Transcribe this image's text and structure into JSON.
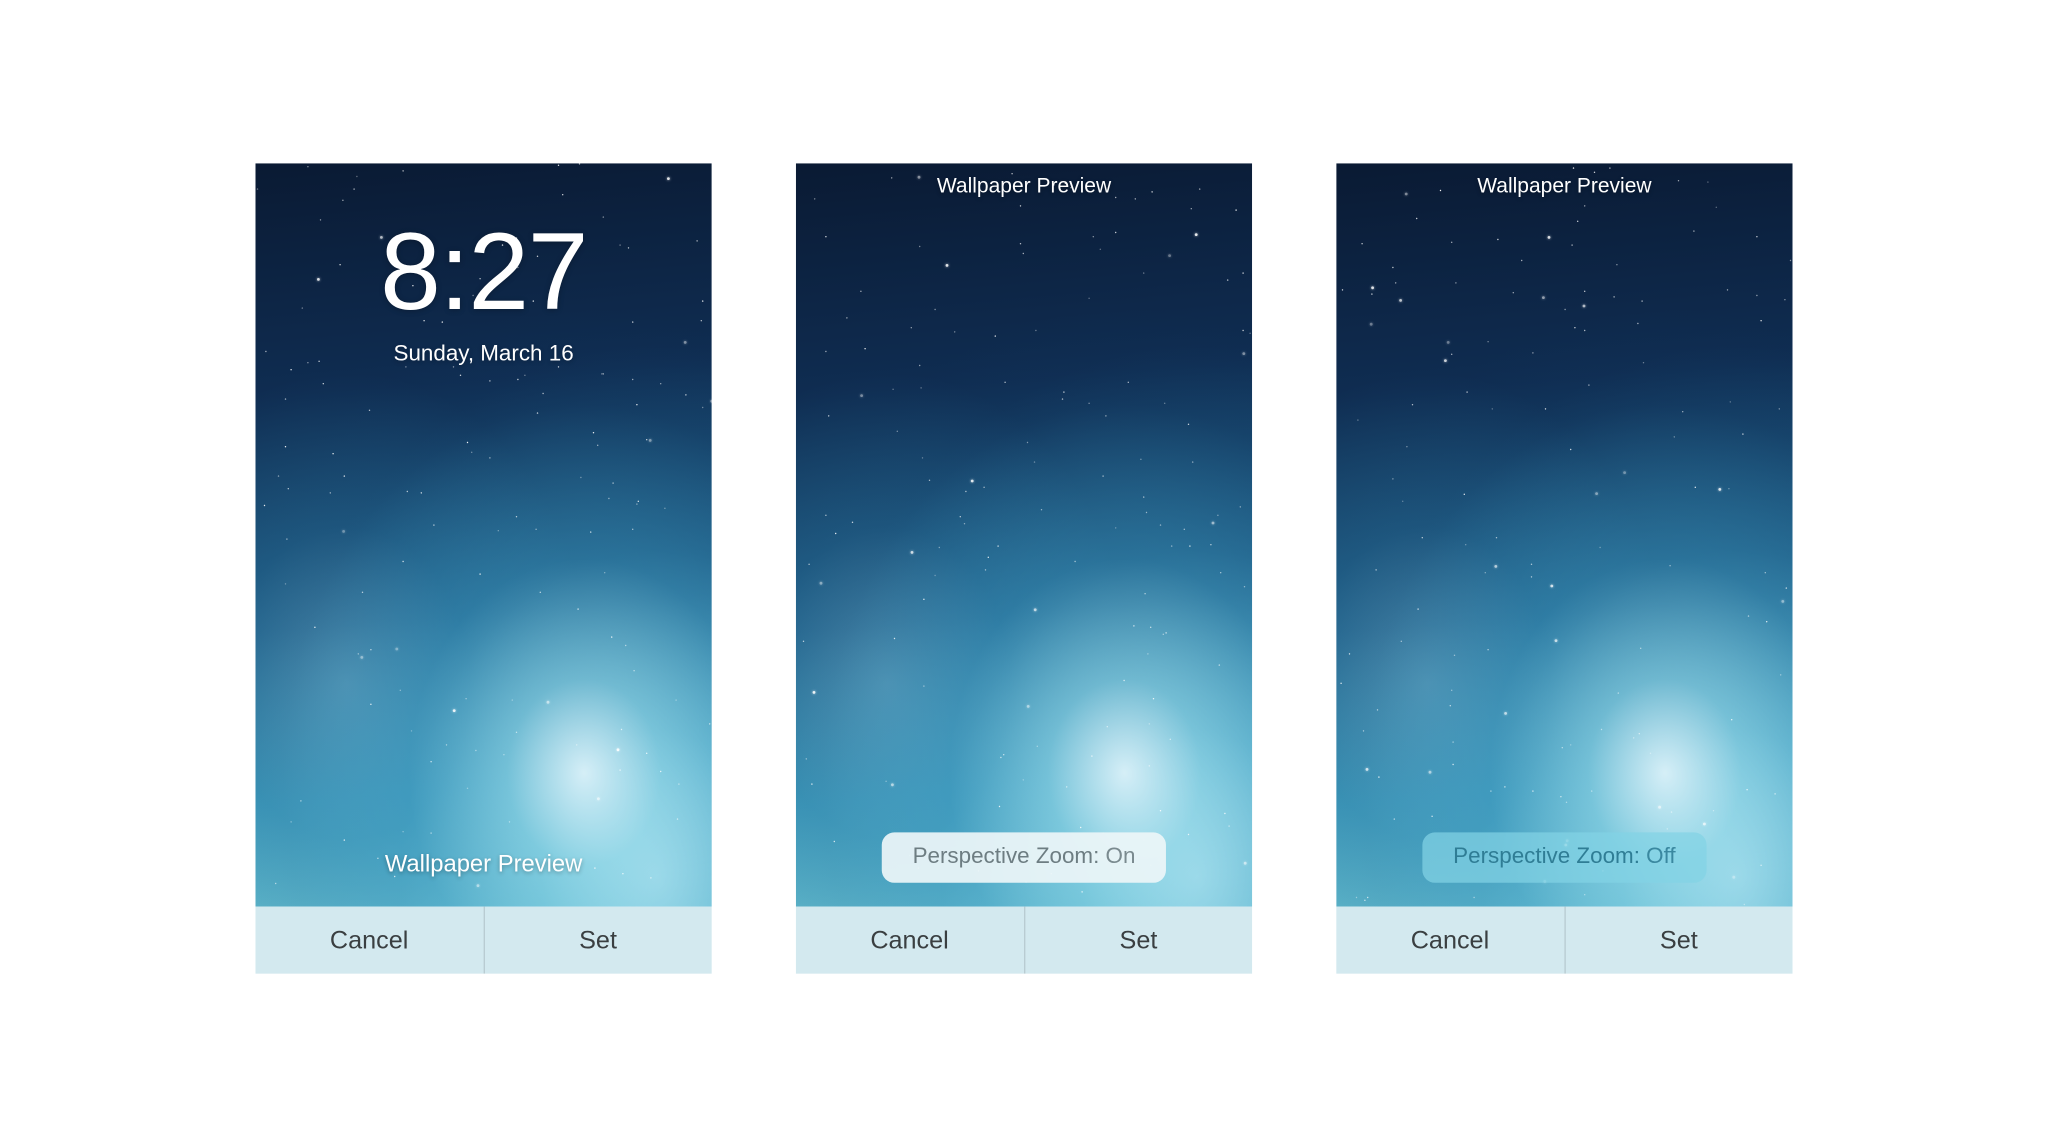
{
  "screens": [
    {
      "header_title": "",
      "lock_time": "8:27",
      "lock_date": "Sunday, March 16",
      "bottom_label": "Wallpaper Preview",
      "zoom_label": "",
      "zoom_value": "",
      "cancel_label": "Cancel",
      "set_label": "Set"
    },
    {
      "header_title": "Wallpaper Preview",
      "lock_time": "",
      "lock_date": "",
      "bottom_label": "",
      "zoom_label": "Perspective Zoom:",
      "zoom_value": "On",
      "cancel_label": "Cancel",
      "set_label": "Set"
    },
    {
      "header_title": "Wallpaper Preview",
      "lock_time": "",
      "lock_date": "",
      "bottom_label": "",
      "zoom_label": "Perspective Zoom:",
      "zoom_value": "Off",
      "cancel_label": "Cancel",
      "set_label": "Set"
    }
  ]
}
